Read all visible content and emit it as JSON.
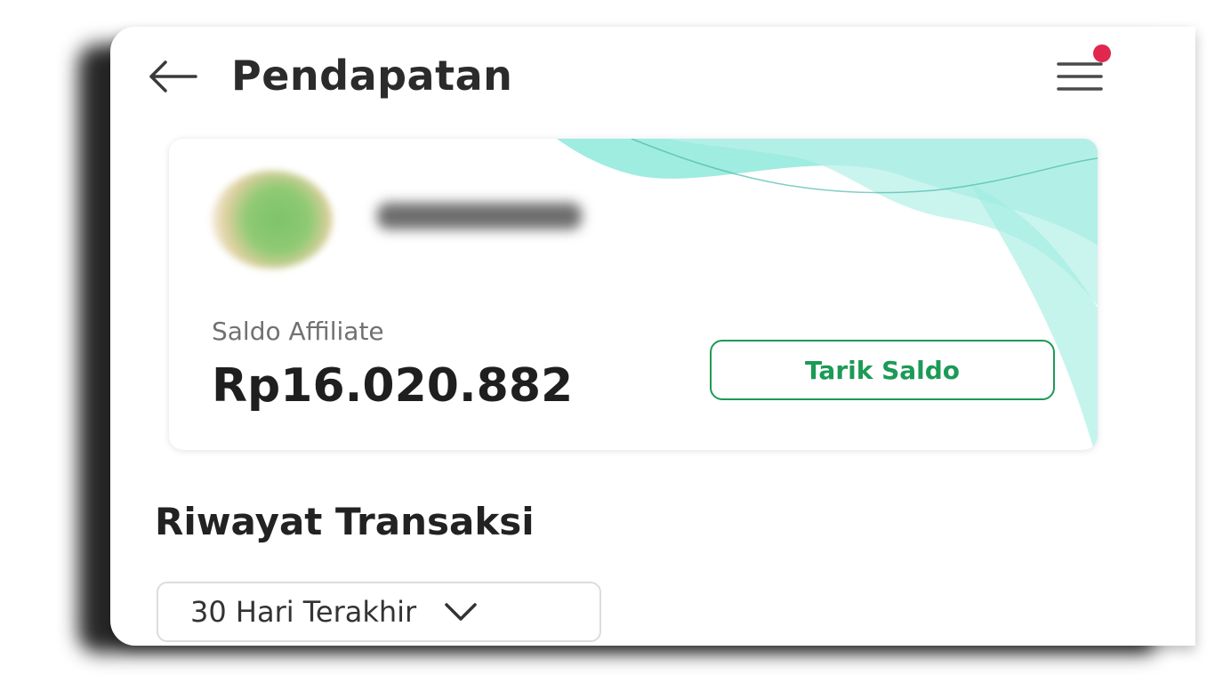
{
  "header": {
    "title": "Pendapatan",
    "back_icon": "arrow-left-icon",
    "menu_icon": "hamburger-menu-icon",
    "notification_color": "#e0284f"
  },
  "balance_card": {
    "label": "Saldo Affiliate",
    "amount": "Rp16.020.882",
    "withdraw_label": "Tarik Saldo",
    "accent_color": "#1c9a56",
    "wave_color": "#8ee9dc"
  },
  "transactions": {
    "title": "Riwayat Transaksi",
    "period_selected": "30 Hari Terakhir",
    "period_icon": "chevron-down-icon"
  }
}
